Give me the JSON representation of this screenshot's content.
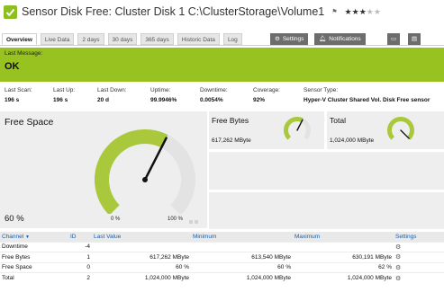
{
  "header": {
    "title": "Sensor Disk Free: Cluster Disk 1 C:\\ClusterStorage\\Volume1",
    "flag_icon": "flag-icon",
    "stars_filled": 3,
    "stars_total": 5
  },
  "tabs": [
    {
      "label": "Overview",
      "active": true
    },
    {
      "label": "Live Data"
    },
    {
      "label": "2 days"
    },
    {
      "label": "30 days"
    },
    {
      "label": "365 days"
    },
    {
      "label": "Historic Data"
    },
    {
      "label": "Log"
    }
  ],
  "toolbar": {
    "settings_label": "Settings",
    "notifications_label": "Notifications"
  },
  "status": {
    "label": "Last Message:",
    "value": "OK",
    "color": "#97c21f"
  },
  "info": [
    {
      "key": "Last Scan:",
      "value": "196 s"
    },
    {
      "key": "Last Up:",
      "value": "196 s"
    },
    {
      "key": "Last Down:",
      "value": "20 d"
    },
    {
      "key": "Uptime:",
      "value": "99.9946%"
    },
    {
      "key": "Downtime:",
      "value": "0.0054%"
    },
    {
      "key": "Coverage:",
      "value": "92%"
    },
    {
      "key": "Sensor Type:",
      "value": "Hyper-V Cluster Shared Vol. Disk Free sensor"
    }
  ],
  "free_space": {
    "title": "Free Space",
    "value": "60 %",
    "gauge_min": "0 %",
    "gauge_max": "100 %",
    "level_fraction": 0.6
  },
  "free_bytes": {
    "title": "Free Bytes",
    "value": "617,262 MByte",
    "level_fraction": 0.6
  },
  "total": {
    "title": "Total",
    "value": "1,024,000 MByte",
    "level_fraction": 1.0
  },
  "table": {
    "headers": [
      "Channel",
      "ID",
      "Last Value",
      "Minimum",
      "Maximum",
      "Settings"
    ],
    "rows": [
      [
        "Downtime",
        "-4",
        "",
        "",
        ""
      ],
      [
        "Free Bytes",
        "1",
        "617,262 MByte",
        "613,540 MByte",
        "630,191 MByte"
      ],
      [
        "Free Space",
        "0",
        "60 %",
        "60 %",
        "62 %"
      ],
      [
        "Total",
        "2",
        "1,024,000 MByte",
        "1,024,000 MByte",
        "1,024,000 MByte"
      ]
    ]
  },
  "colors": {
    "accent": "#97c21f",
    "dark_button": "#6d6d6d",
    "link_header": "#1d5fa6"
  }
}
